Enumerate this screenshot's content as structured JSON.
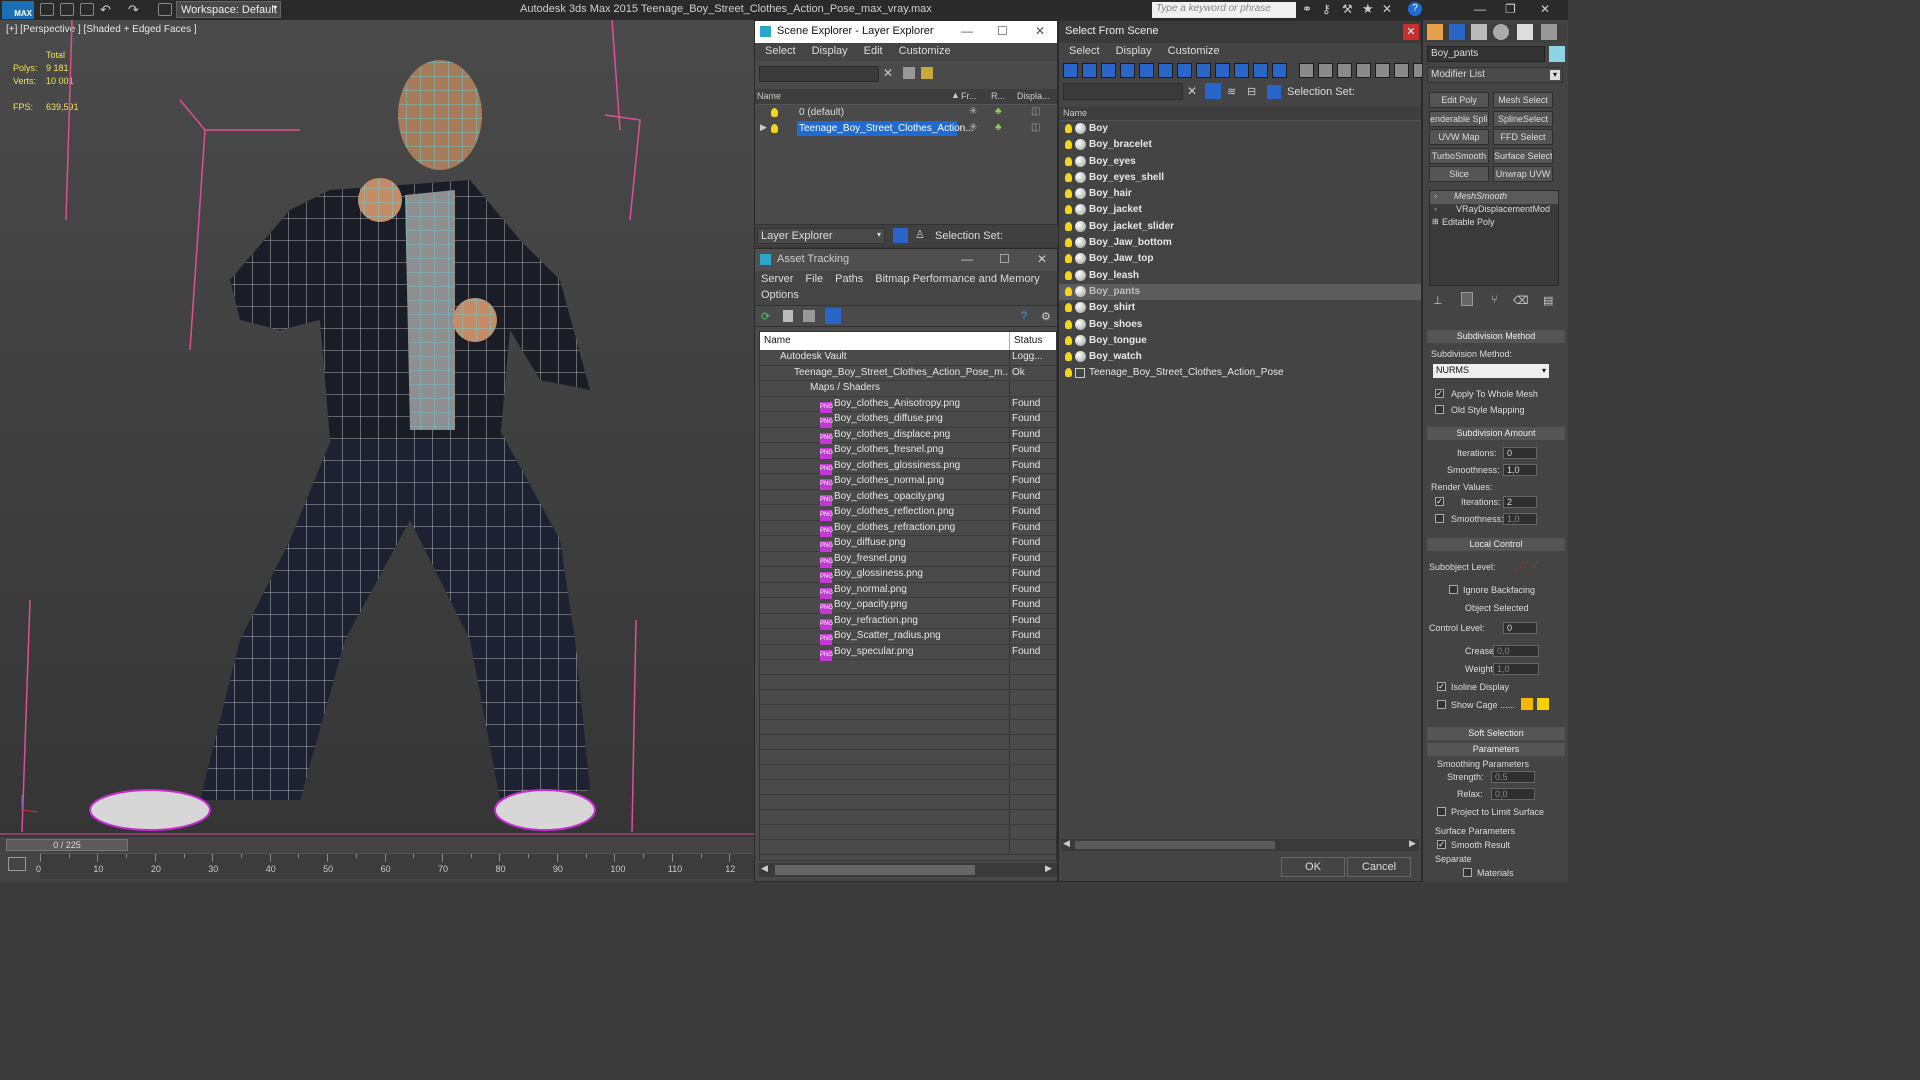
{
  "app": {
    "workspace": "Workspace: Default",
    "title": "Autodesk 3ds Max  2015      Teenage_Boy_Street_Clothes_Action_Pose_max_vray.max",
    "search_placeholder": "Type a keyword or phrase",
    "logo": "MAX"
  },
  "viewport": {
    "label": "[+] [Perspective ] [Shaded + Edged Faces ]",
    "total": "Total",
    "polys_label": "Polys:",
    "polys": "9 181",
    "verts_label": "Verts:",
    "verts": "10 001",
    "fps_label": "FPS:",
    "fps": "639,591"
  },
  "timeline": {
    "frame": "0 / 225",
    "ticks": [
      "0",
      "10",
      "20",
      "30",
      "40",
      "50",
      "60",
      "70",
      "80",
      "90",
      "100",
      "110",
      "12"
    ]
  },
  "scene_explorer": {
    "title": "Scene Explorer - Layer Explorer",
    "menu": [
      "Select",
      "Display",
      "Edit",
      "Customize"
    ],
    "col_name": "Name",
    "col_fr": "Fr...",
    "col_r": "R...",
    "col_disp": "Displa...",
    "layers": [
      "0 (default)",
      "Teenage_Boy_Street_Clothes_Action..."
    ],
    "footer_label": "Layer Explorer",
    "selection_set": "Selection Set:"
  },
  "asset_tracking": {
    "title": "Asset Tracking",
    "menu": [
      "Server",
      "File",
      "Paths",
      "Bitmap Performance and Memory"
    ],
    "menu2": "Options",
    "col_name": "Name",
    "col_status": "Status",
    "rows": [
      {
        "name": "Autodesk Vault",
        "status": "Logg...",
        "indent": 0
      },
      {
        "name": "Teenage_Boy_Street_Clothes_Action_Pose_m...",
        "status": "Ok",
        "indent": 1
      },
      {
        "name": "Maps / Shaders",
        "status": "",
        "indent": 2
      },
      {
        "name": "Boy_clothes_Anisotropy.png",
        "status": "Found",
        "indent": 3
      },
      {
        "name": "Boy_clothes_diffuse.png",
        "status": "Found",
        "indent": 3
      },
      {
        "name": "Boy_clothes_displace.png",
        "status": "Found",
        "indent": 3
      },
      {
        "name": "Boy_clothes_fresnel.png",
        "status": "Found",
        "indent": 3
      },
      {
        "name": "Boy_clothes_glossiness.png",
        "status": "Found",
        "indent": 3
      },
      {
        "name": "Boy_clothes_normal.png",
        "status": "Found",
        "indent": 3
      },
      {
        "name": "Boy_clothes_opacity.png",
        "status": "Found",
        "indent": 3
      },
      {
        "name": "Boy_clothes_reflection.png",
        "status": "Found",
        "indent": 3
      },
      {
        "name": "Boy_clothes_refraction.png",
        "status": "Found",
        "indent": 3
      },
      {
        "name": "Boy_diffuse.png",
        "status": "Found",
        "indent": 3
      },
      {
        "name": "Boy_fresnel.png",
        "status": "Found",
        "indent": 3
      },
      {
        "name": "Boy_glossiness.png",
        "status": "Found",
        "indent": 3
      },
      {
        "name": "Boy_normal.png",
        "status": "Found",
        "indent": 3
      },
      {
        "name": "Boy_opacity.png",
        "status": "Found",
        "indent": 3
      },
      {
        "name": "Boy_refraction.png",
        "status": "Found",
        "indent": 3
      },
      {
        "name": "Boy_Scatter_radius.png",
        "status": "Found",
        "indent": 3
      },
      {
        "name": "Boy_specular.png",
        "status": "Found",
        "indent": 3
      }
    ]
  },
  "select_from_scene": {
    "title": "Select From Scene",
    "menu": [
      "Select",
      "Display",
      "Customize"
    ],
    "selection_set": "Selection Set:",
    "col_name": "Name",
    "objects": [
      "Boy",
      "Boy_bracelet",
      "Boy_eyes",
      "Boy_eyes_shell",
      "Boy_hair",
      "Boy_jacket",
      "Boy_jacket_slider",
      "Boy_Jaw_bottom",
      "Boy_Jaw_top",
      "Boy_leash",
      "Boy_pants",
      "Boy_shirt",
      "Boy_shoes",
      "Boy_tongue",
      "Boy_watch"
    ],
    "group": "Teenage_Boy_Street_Clothes_Action_Pose",
    "selected": "Boy_pants",
    "ok": "OK",
    "cancel": "Cancel"
  },
  "command_panel": {
    "object_name": "Boy_pants",
    "modifier_list": "Modifier List",
    "buttons": [
      "Edit Poly",
      "Mesh Select",
      "enderable Splir",
      "SplineSelect",
      "UVW Map",
      "FFD Select",
      "TurboSmooth",
      "Surface Select",
      "Slice",
      "Unwrap UVW"
    ],
    "stack": [
      "MeshSmooth",
      "VRayDisplacementMod",
      "Editable Poly"
    ],
    "subdiv_method_title": "Subdivision Method",
    "subdiv_method_label": "Subdivision Method:",
    "subdiv_method": "NURMS",
    "apply_whole": "Apply To Whole Mesh",
    "old_style": "Old Style Mapping",
    "subdiv_amount_title": "Subdivision Amount",
    "iterations_label": "Iterations:",
    "iterations": "0",
    "smoothness_label": "Smoothness:",
    "smoothness": "1,0",
    "render_values": "Render Values:",
    "r_iterations": "2",
    "r_smoothness": "1,0",
    "local_control_title": "Local Control",
    "subobject_level": "Subobject Level:",
    "ignore_backfacing": "Ignore Backfacing",
    "object_selected": "Object Selected",
    "control_level_label": "Control Level:",
    "control_level": "0",
    "crease_label": "Crease:",
    "crease": "0,0",
    "weight_label": "Weight:",
    "weight": "1,0",
    "isoline": "Isoline Display",
    "show_cage": "Show Cage ......",
    "soft_selection": "Soft Selection",
    "parameters": "Parameters",
    "smoothing_params": "Smoothing Parameters",
    "strength_label": "Strength:",
    "strength": "0,5",
    "relax_label": "Relax:",
    "relax": "0,0",
    "project": "Project to Limit Surface",
    "surface_params": "Surface Parameters",
    "smooth_result": "Smooth Result",
    "separate": "Separate",
    "materials": "Materials"
  },
  "colors": {
    "accent": "#1e6bd6",
    "found_icon": "#c23ad1",
    "bulb": "#f5d51a",
    "cage1": "#f5b800",
    "cage2": "#f5d000"
  }
}
